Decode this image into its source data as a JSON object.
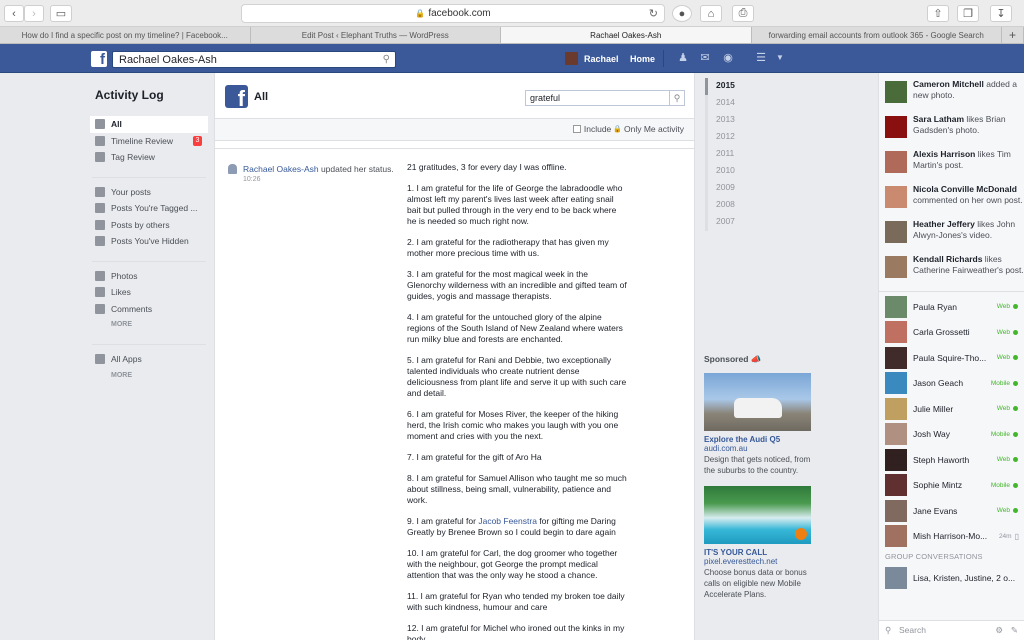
{
  "browser": {
    "url": "facebook.com",
    "tabs": [
      {
        "label": "How do I find a specific post on my timeline? | Facebook...",
        "active": false
      },
      {
        "label": "Edit Post ‹ Elephant Truths — WordPress",
        "active": false
      },
      {
        "label": "Rachael Oakes-Ash",
        "active": true
      },
      {
        "label": "forwarding email accounts from outlook 365 - Google Search",
        "active": false
      }
    ],
    "new_tab": "+"
  },
  "fbbar": {
    "search_value": "Rachael Oakes-Ash",
    "user_name": "Rachael",
    "home_label": "Home"
  },
  "leftnav": {
    "title": "Activity Log",
    "group1": [
      {
        "label": "All",
        "selected": true
      },
      {
        "label": "Timeline Review",
        "badge": "3"
      },
      {
        "label": "Tag Review"
      }
    ],
    "group2": [
      {
        "label": "Your posts"
      },
      {
        "label": "Posts You're Tagged ..."
      },
      {
        "label": "Posts by others"
      },
      {
        "label": "Posts You've Hidden"
      }
    ],
    "group3": [
      {
        "label": "Photos"
      },
      {
        "label": "Likes"
      },
      {
        "label": "Comments"
      }
    ],
    "more1": "MORE",
    "group4": [
      {
        "label": "All Apps"
      }
    ],
    "more2": "MORE"
  },
  "main": {
    "title": "All",
    "search_value": "grateful",
    "include_label": "Include",
    "only_me_label": "Only Me activity",
    "entry": {
      "author": "Rachael Oakes-Ash",
      "action": " updated her status.",
      "time": "10:26",
      "paragraphs": [
        "21 gratitudes, 3 for every day I was offline.",
        "1. I am grateful for the life of George the labradoodle who almost left my parent's lives last week after eating snail bait but pulled through in the very end to be back where he is needed so much right now.",
        "2. I am grateful for the radiotherapy that has given my mother more precious time with us.",
        "3. I am grateful for the most magical week in the Glenorchy wilderness with an incredible and gifted team of guides, yogis and massage therapists.",
        "4. I am grateful for the untouched glory of the alpine regions of the South Island of New Zealand where waters run milky blue and forests are enchanted.",
        "5. I am grateful for Rani and Debbie, two exceptionally talented individuals who create nutrient dense deliciousness from plant life and serve it up with such care and detail.",
        "6. I am grateful for Moses River, the keeper of the hiking herd, the Irish comic who makes you laugh with you one moment and cries with you the next.",
        "7. I am grateful for the gift of Aro Ha",
        "8. I am grateful for Samuel Allison who taught me so much about stillness, being small, vulnerability, patience and work."
      ],
      "p9_pre": "9. I am grateful for ",
      "p9_link": "Jacob Feenstra",
      "p9_post": " for gifting me Daring Greatly by Brenee Brown so I could begin to dare again",
      "paragraphs2": [
        "10. I am grateful for Carl, the dog groomer who together with the neighbour, got George the prompt medical attention that was the only way he stood a chance.",
        "11. I am grateful for Ryan who tended my broken toe daily with such kindness, humour and care",
        "12. I am grateful for Michel who ironed out the kinks in my body"
      ]
    }
  },
  "years": [
    "2015",
    "2014",
    "2013",
    "2012",
    "2011",
    "2010",
    "2009",
    "2008",
    "2007"
  ],
  "sponsored": {
    "label": "Sponsored",
    "ads": [
      {
        "title": "Explore the Audi Q5",
        "url": "audi.com.au",
        "desc": "Design that gets noticed, from the suburbs to the country."
      },
      {
        "title": "IT'S YOUR CALL",
        "url": "pixel.everesttech.net",
        "desc": "Choose bonus data or bonus calls on eligible new Mobile Accelerate Plans."
      }
    ]
  },
  "ticker": [
    {
      "name": "Cameron Mitchell",
      "text": " added a new photo.",
      "color": "#4a6b3a"
    },
    {
      "name": "Sara Latham",
      "text": " likes Brian Gadsden's photo.",
      "color": "#8a1010"
    },
    {
      "name": "Alexis Harrison",
      "text": " likes Tim Martin's post.",
      "color": "#b06a5a"
    },
    {
      "name": "Nicola Conville McDonald",
      "text": " commented on her own post.",
      "color": "#c98a70"
    },
    {
      "name": "Heather Jeffery",
      "text": " likes John Alwyn-Jones's video.",
      "color": "#7a6a5a"
    },
    {
      "name": "Kendall Richards",
      "text": " likes Catherine Fairweather's post.",
      "color": "#9a7a60"
    }
  ],
  "chat": [
    {
      "name": "Paula Ryan",
      "status": "Web",
      "color": "#6a8a6a"
    },
    {
      "name": "Carla Grossetti",
      "status": "Web",
      "color": "#c07060"
    },
    {
      "name": "Paula Squire-Tho...",
      "status": "Web",
      "color": "#402a2a"
    },
    {
      "name": "Jason Geach",
      "status": "Mobile",
      "color": "#3a8ac0"
    },
    {
      "name": "Julie Miller",
      "status": "Web",
      "color": "#c0a060"
    },
    {
      "name": "Josh Way",
      "status": "Mobile",
      "color": "#b09080"
    },
    {
      "name": "Steph Haworth",
      "status": "Web",
      "color": "#302020"
    },
    {
      "name": "Sophie Mintz",
      "status": "Mobile",
      "color": "#603030"
    },
    {
      "name": "Jane Evans",
      "status": "Web",
      "color": "#806a60"
    },
    {
      "name": "Mish Harrison-Mo...",
      "status": "24m",
      "color": "#a07060"
    }
  ],
  "group_conversations": {
    "label": "GROUP CONVERSATIONS",
    "item": "Lisa, Kristen, Justine, 2 o..."
  },
  "chat_search_placeholder": "Search"
}
